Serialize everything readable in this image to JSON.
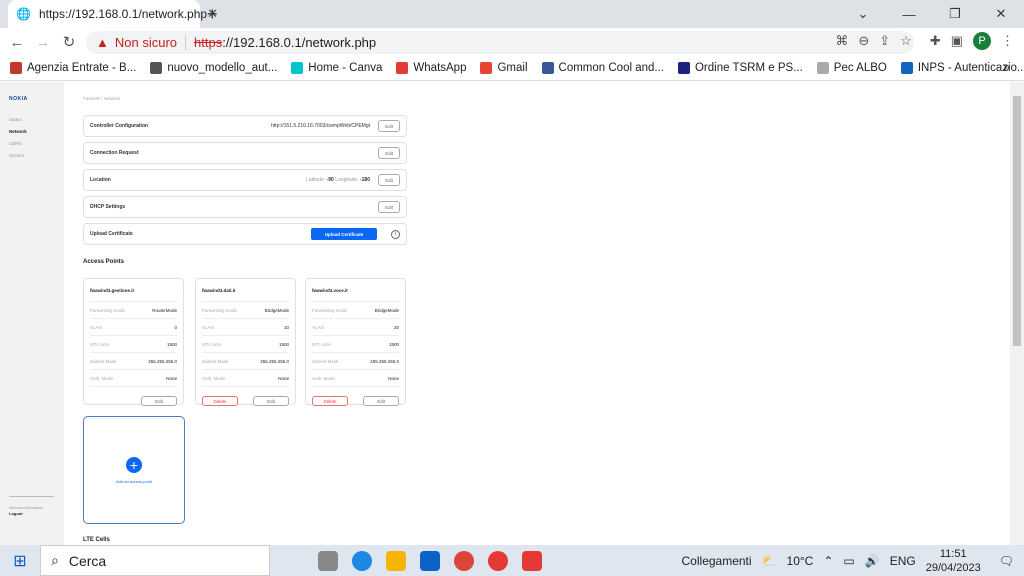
{
  "browser": {
    "tab_title": "https://192.168.0.1/network.php",
    "security_label": "Non sicuro",
    "url_scheme": "https",
    "url_rest": "://192.168.0.1/network.php",
    "profile_initial": "P",
    "bookmarks": [
      {
        "label": "Agenzia Entrate - B...",
        "color": "#c0392b"
      },
      {
        "label": "nuovo_modello_aut...",
        "color": "#555"
      },
      {
        "label": "Home - Canva",
        "color": "#00c4cc"
      },
      {
        "label": "WhatsApp",
        "color": "#e53935"
      },
      {
        "label": "Gmail",
        "color": "#ea4335"
      },
      {
        "label": "Common Cool and...",
        "color": "#3b5998"
      },
      {
        "label": "Ordine TSRM e PS...",
        "color": "#1a237e"
      },
      {
        "label": "Pec ALBO",
        "color": "#aaa"
      },
      {
        "label": "INPS - Autenticazio...",
        "color": "#1565c0"
      }
    ]
  },
  "sidebar": {
    "logo": "NOKIA",
    "items": [
      "Status",
      "Network",
      "CBRS",
      "System"
    ],
    "welcome": "Welcome fn@installer",
    "logout": "Logout"
  },
  "breadcrumb": "Fastmile / Network",
  "settings": {
    "controller": {
      "label": "Controller Configuration",
      "value": "http://151.5.210.16:7003/cwmpWeb/CPEMgt",
      "edit": "Edit"
    },
    "connection": {
      "label": "Connection Request",
      "edit": "Edit"
    },
    "location": {
      "label": "Location",
      "lat_label": "Latitude:",
      "lat": "-90",
      "lon_label": "Longitude:",
      "lon": "-180",
      "edit": "Edit"
    },
    "dhcp": {
      "label": "DHCP Settings",
      "edit": "Edit"
    },
    "upload": {
      "label": "Upload Certificate",
      "button": "Upload Certificate"
    }
  },
  "access_points_title": "Access Points",
  "field_labels": [
    "Forwarding mode",
    "VLAN",
    "MTU size",
    "Subnet Mask",
    "Auth. Mode"
  ],
  "access_points": [
    {
      "name": "fwawind3.gestione.it",
      "values": [
        "RouterMode",
        "0",
        "1500",
        "255.255.255.0",
        "None"
      ],
      "delete": null,
      "edit": "Edit"
    },
    {
      "name": "fwawind3.dati.it",
      "values": [
        "BridgeMode",
        "10",
        "1500",
        "255.255.255.0",
        "None"
      ],
      "delete": "Delete",
      "edit": "Edit"
    },
    {
      "name": "fwawind3.voce.it",
      "values": [
        "BridgeMode",
        "20",
        "1500",
        "255.255.255.0",
        "None"
      ],
      "delete": "Delete",
      "edit": "Edit"
    }
  ],
  "add_access_point": "Add an access point",
  "lte_title": "LTE Cells",
  "taskbar": {
    "search": "Cerca",
    "links": "Collegamenti",
    "weather": "10°C",
    "lang": "ENG",
    "time": "11:51",
    "date": "29/04/2023"
  }
}
